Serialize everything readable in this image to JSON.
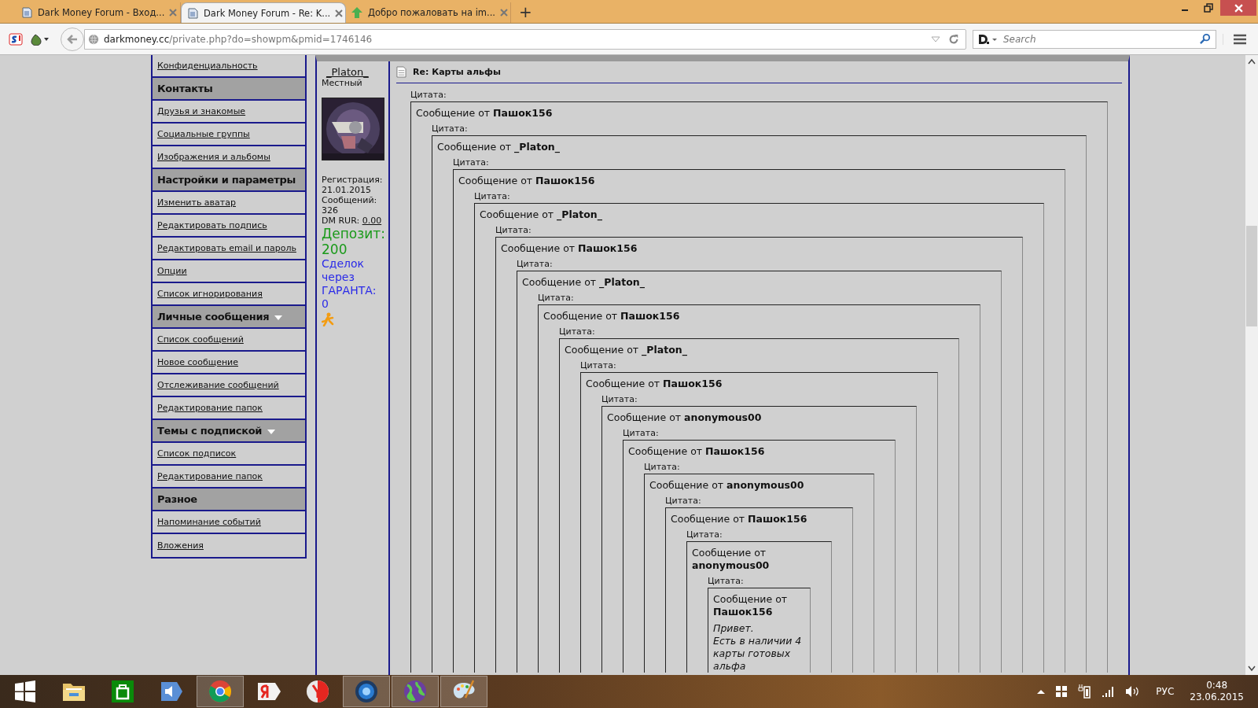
{
  "browser": {
    "tabs": [
      {
        "title": "Dark Money Forum - Вход...",
        "selected": false
      },
      {
        "title": "Dark Money Forum - Re: K...",
        "selected": true
      },
      {
        "title": "Добро пожаловать на im...",
        "selected": false
      }
    ],
    "new_tab": "+",
    "url_host": "darkmoney.cc",
    "url_path": "/private.php?do=showpm&pmid=1746146",
    "search_placeholder": "Search"
  },
  "sidebar": [
    {
      "kind": "link",
      "label": "Конфиденциальность"
    },
    {
      "kind": "header",
      "label": "Контакты",
      "dropdown": false
    },
    {
      "kind": "link",
      "label": "Друзья и знакомые"
    },
    {
      "kind": "link",
      "label": "Социальные группы"
    },
    {
      "kind": "link",
      "label": "Изображения и альбомы"
    },
    {
      "kind": "header",
      "label": "Настройки и параметры",
      "dropdown": false
    },
    {
      "kind": "link",
      "label": "Изменить аватар"
    },
    {
      "kind": "link",
      "label": "Редактировать подпись"
    },
    {
      "kind": "link",
      "label": "Редактировать email и пароль"
    },
    {
      "kind": "link",
      "label": "Опции"
    },
    {
      "kind": "link",
      "label": "Список игнорирования"
    },
    {
      "kind": "header",
      "label": "Личные сообщения",
      "dropdown": true
    },
    {
      "kind": "link",
      "label": "Список сообщений"
    },
    {
      "kind": "link",
      "label": "Новое сообщение"
    },
    {
      "kind": "link",
      "label": "Отслеживание сообщений"
    },
    {
      "kind": "link",
      "label": "Редактирование папок"
    },
    {
      "kind": "header",
      "label": "Темы с подпиской",
      "dropdown": true
    },
    {
      "kind": "link",
      "label": "Список подписок"
    },
    {
      "kind": "link",
      "label": "Редактирование папок"
    },
    {
      "kind": "header",
      "label": "Разное",
      "dropdown": false
    },
    {
      "kind": "link",
      "label": "Напоминание событий"
    },
    {
      "kind": "link",
      "label": "Вложения"
    }
  ],
  "post": {
    "username": "_Platon_",
    "rank": "Местный",
    "registration_label": "Регистрация:",
    "registration": "21.01.2015",
    "posts_label": "Сообщений:",
    "posts": "326",
    "dm_label": "DM RUR:",
    "dm_value": "0.00",
    "deposit": "Депозит: 200",
    "deals": "Сделок через ГАРАНТА: 0",
    "title": "Re: Карты альфы",
    "quote": {
      "label": "Цитата:",
      "header": "Сообщение от **Пашок156**",
      "quote": {
        "label": "Цитата:",
        "header": "Сообщение от **_Platon_**",
        "quote": {
          "label": "Цитата:",
          "header": "Сообщение от **Пашок156**",
          "quote": {
            "label": "Цитата:",
            "header": "Сообщение от **_Platon_**",
            "quote": {
              "label": "Цитата:",
              "header": "Сообщение от **Пашок156**",
              "quote": {
                "label": "Цитата:",
                "header": "Сообщение от **_Platon_**",
                "quote": {
                  "label": "Цитата:",
                  "header": "Сообщение от **Пашок156**",
                  "quote": {
                    "label": "Цитата:",
                    "header": "Сообщение от **_Platon_**",
                    "quote": {
                      "label": "Цитата:",
                      "header": "Сообщение от **Пашок156**",
                      "quote": {
                        "label": "Цитата:",
                        "header": "Сообщение от **anonymous00**",
                        "quote": {
                          "label": "Цитата:",
                          "header": "Сообщение от **Пашок156**",
                          "quote": {
                            "label": "Цитата:",
                            "header": "Сообщение от **anonymous00**",
                            "quote": {
                              "label": "Цитата:",
                              "header": "Сообщение от **Пашок156**",
                              "quote": {
                                "label": "Цитата:",
                                "header": "Сообщение от **anonymous00**",
                                "quote": {
                                  "label": "Цитата:",
                                  "header": "Сообщение от **Пашок156**",
                                  "lines": [
                                    "Привет.",
                                    "Есть в наличии 4 карты готовых альфа"
                                  ]
                                }
                              }
                            }
                          }
                        }
                      }
                    }
                  }
                }
              }
            }
          }
        }
      }
    }
  },
  "taskbar": {
    "apps": [
      {
        "kind": "folder",
        "running": false
      },
      {
        "kind": "store",
        "running": false
      },
      {
        "kind": "speaker",
        "running": false
      },
      {
        "kind": "chrome",
        "running": true
      },
      {
        "kind": "yandex",
        "running": false
      },
      {
        "kind": "yabrowser",
        "running": false
      },
      {
        "kind": "disc",
        "running": true
      },
      {
        "kind": "globe",
        "running": true
      },
      {
        "kind": "paint",
        "running": true
      }
    ],
    "language": "РУС",
    "time": "0:48",
    "date": "23.06.2015"
  }
}
